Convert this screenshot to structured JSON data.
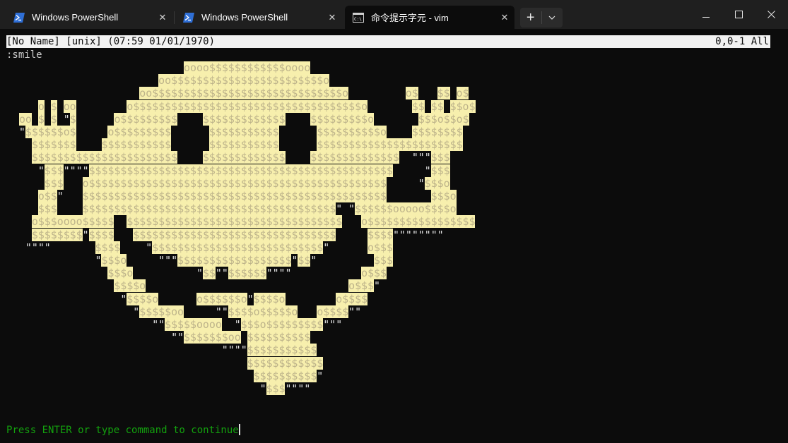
{
  "tabs": [
    {
      "label": "Windows PowerShell",
      "icon": "powershell-icon",
      "active": false
    },
    {
      "label": "Windows PowerShell",
      "icon": "powershell-icon",
      "active": false
    },
    {
      "label": "命令提示字元 - vim",
      "icon": "cmd-icon",
      "active": true
    }
  ],
  "window_controls": {
    "minimize": "minimize-icon",
    "maximize": "maximize-icon",
    "close": "close-icon"
  },
  "vim": {
    "status_left": "[No Name] [unix] (07:59 01/01/1970)",
    "status_right": "0,0-1 All",
    "command": ":smile",
    "art_lines": [
      "                            oooo$$$$$$$$$$$$oooo",
      "                        oo$$$$$$$$$$$$$$$$$$$$$$$$o",
      "                     oo$$$$$$$$$$$$$$$$$$$$$$$$$$$$$$o         o$   $$ o$",
      "     o $ oo        o$$$$$$$$$$$$$$$$$$$$$$$$$$$$$$$$$$$$o       $$ $$ $$o$",
      "  oo $ $ \"$      o$$$$$$$$$    $$$$$$$$$$$$$    $$$$$$$$$o       $$$o$$o$",
      "  \"$$$$$$o$     o$$$$$$$$$      $$$$$$$$$$$      $$$$$$$$$$o    $$$$$$$$",
      "    $$$$$$$    $$$$$$$$$$$      $$$$$$$$$$$      $$$$$$$$$$$$$$$$$$$$$$$",
      "    $$$$$$$$$$$$$$$$$$$$$$$    $$$$$$$$$$$$$    $$$$$$$$$$$$$$  \"\"\"$$$",
      "     \"$$$\"\"\"\"$$$$$$$$$$$$$$$$$$$$$$$$$$$$$$$$$$$$$$$$$$$$$$$$     \"$$$",
      "      $$$   o$$$$$$$$$$$$$$$$$$$$$$$$$$$$$$$$$$$$$$$$$$$$$$$     \"$$$o",
      "     o$$\"   $$$$$$$$$$$$$$$$$$$$$$$$$$$$$$$$$$$$$$$$$$$$$$$$       $$$o",
      "     $$$    $$$$$$$$$$$$$$$$$$$$$$$$$$$$$$$$$$$$$$$$\" \"$$$$$$ooooo$$$$o",
      "    o$$$oooo$$$$$  $$$$$$$$$$$$$$$$$$$$$$$$$$$$$$$$$$   o$$$$$$$$$$$$$$$$$",
      "    $$$$$$$$\"$$$$   $$$$$$$$$$$$$$$$$$$$$$$$$$$$$$$$     $$$$\"\"\"\"\"\"\"\"",
      "   \"\"\"\"       $$$$    \"$$$$$$$$$$$$$$$$$$$$$$$$$$$\"      o$$$",
      "              \"$$$o     \"\"\"$$$$$$$$$$$$$$$$$$\"$$\"         $$$",
      "                $$$o          \"$$\"\"$$$$$$\"\"\"\"           o$$$",
      "                 $$$$o                                o$$$\"",
      "                  \"$$$$o      o$$$$$$o\"$$$$o        o$$$$",
      "                    \"$$$$$oo     \"\"$$$$o$$$$$o   o$$$$\"\"",
      "                       \"\"$$$$$oooo  \"$$$o$$$$$$$$$\"\"\"",
      "                          \"\"$$$$$$$oo $$$$$$$$$$",
      "                                  \"\"\"\"$$$$$$$$$$$",
      "                                      $$$$$$$$$$$$",
      "                                       $$$$$$$$$$\"",
      "                                        \"$$$\"\"\"\""
    ],
    "prompt": "Press ENTER or type command to continue"
  },
  "colors": {
    "terminal_bg": "#0c0c0c",
    "art_fill": "#f7efad",
    "prompt_green": "#13a10e",
    "statusline_bg": "#f2f2f2"
  }
}
